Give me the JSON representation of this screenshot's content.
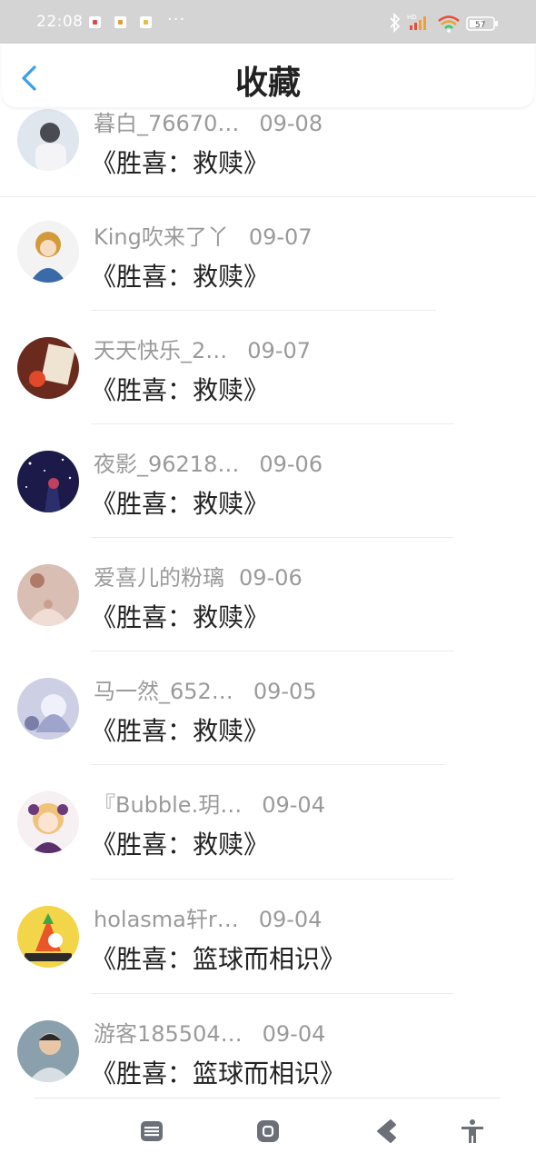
{
  "status_bar": {
    "time": "22:08",
    "dots": "···",
    "battery": "57",
    "signal_label": "HD"
  },
  "header": {
    "title": "收藏",
    "back_icon": "chevron-left-icon"
  },
  "items": [
    {
      "user": "暮白_76670…",
      "date": "09-08",
      "book": "《胜喜：救赎》"
    },
    {
      "user": "King吹来了丫",
      "date": "09-07",
      "book": "《胜喜：救赎》"
    },
    {
      "user": "天天快乐_2…",
      "date": "09-07",
      "book": "《胜喜：救赎》"
    },
    {
      "user": "夜影_96218…",
      "date": "09-06",
      "book": "《胜喜：救赎》"
    },
    {
      "user": "爱喜儿的粉璃",
      "date": "09-06",
      "book": "《胜喜：救赎》"
    },
    {
      "user": "马一然_652…",
      "date": "09-05",
      "book": "《胜喜：救赎》"
    },
    {
      "user": "『Bubble.玥…",
      "date": "09-04",
      "book": "《胜喜：救赎》"
    },
    {
      "user": "holasma轩r…",
      "date": "09-04",
      "book": "《胜喜：篮球而相识》"
    },
    {
      "user": "游客185504…",
      "date": "09-04",
      "book": "《胜喜：篮球而相识》"
    }
  ],
  "nav": {
    "menu_icon": "menu-icon",
    "home_icon": "home-icon",
    "back_icon": "back-icon",
    "accessibility_icon": "accessibility-icon"
  },
  "colors": {
    "accent": "#3a9ee8",
    "meta_text": "#9a9a9a",
    "title_text": "#222222"
  }
}
